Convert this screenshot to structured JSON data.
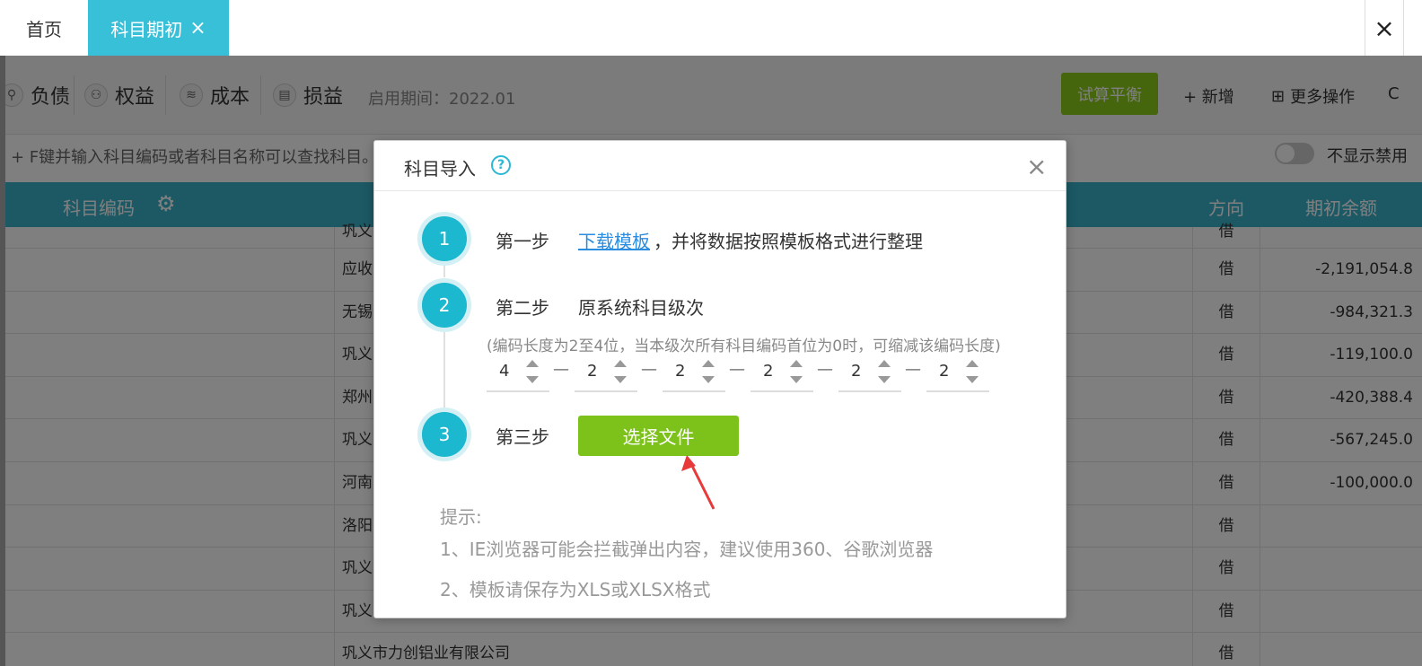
{
  "tabs": {
    "home": "首页",
    "active": "科目期初",
    "active_close": "×",
    "window_close": "×"
  },
  "toolbar": {
    "categories": [
      {
        "label": "负债",
        "icon": "liability-icon"
      },
      {
        "label": "权益",
        "icon": "equity-icon"
      },
      {
        "label": "成本",
        "icon": "cost-icon"
      },
      {
        "label": "损益",
        "icon": "profit-loss-icon"
      }
    ],
    "period": "启用期间：2022.01",
    "trial_balance": "试算平衡",
    "add": "+ 新增",
    "more": "更多操作",
    "refresh": "C"
  },
  "hint": {
    "text": "+ F键并输入科目编码或者科目名称可以查找科目。",
    "toggle_label": "不显示禁用"
  },
  "table": {
    "col_code": "科目编码",
    "col_direction": "方向",
    "col_balance": "期初余额",
    "rows": [
      {
        "name": "巩义",
        "dir": "借",
        "bal": ""
      },
      {
        "name": "应收",
        "dir": "借",
        "bal": "-2,191,054.8"
      },
      {
        "name": "无锡",
        "dir": "借",
        "bal": "-984,321.3"
      },
      {
        "name": "巩义",
        "dir": "借",
        "bal": "-119,100.0"
      },
      {
        "name": "郑州",
        "dir": "借",
        "bal": "-420,388.4"
      },
      {
        "name": "巩义",
        "dir": "借",
        "bal": "-567,245.0"
      },
      {
        "name": "河南",
        "dir": "借",
        "bal": "-100,000.0"
      },
      {
        "name": "洛阳",
        "dir": "借",
        "bal": ""
      },
      {
        "name": "巩义",
        "dir": "借",
        "bal": ""
      },
      {
        "name": "巩义",
        "dir": "借",
        "bal": ""
      },
      {
        "name": "巩义市力创铝业有限公司",
        "dir": "借",
        "bal": ""
      }
    ]
  },
  "modal": {
    "title": "科目导入",
    "help": "?",
    "close": "×",
    "step1": {
      "num": "1",
      "label": "第一步",
      "link": "下载模板",
      "rest": "，并将数据按照模板格式进行整理"
    },
    "step2": {
      "num": "2",
      "label": "第二步",
      "text": "原系统科目级次",
      "note": "(编码长度为2至4位，当本级次所有科目编码首位为0时，可缩减该编码长度)",
      "levels": [
        "4",
        "2",
        "2",
        "2",
        "2",
        "2"
      ],
      "dash": "—"
    },
    "step3": {
      "num": "3",
      "label": "第三步",
      "button": "选择文件"
    },
    "tips_title": "提示:",
    "tips": [
      "1、IE浏览器可能会拦截弹出内容，建议使用360、谷歌浏览器",
      "2、模板请保存为XLS或XLSX格式"
    ]
  },
  "colors": {
    "accent": "#38c0d9",
    "header": "#38b2c9",
    "green": "#7cc21a",
    "link": "#2b8de0",
    "arrow": "#e83a3a"
  }
}
